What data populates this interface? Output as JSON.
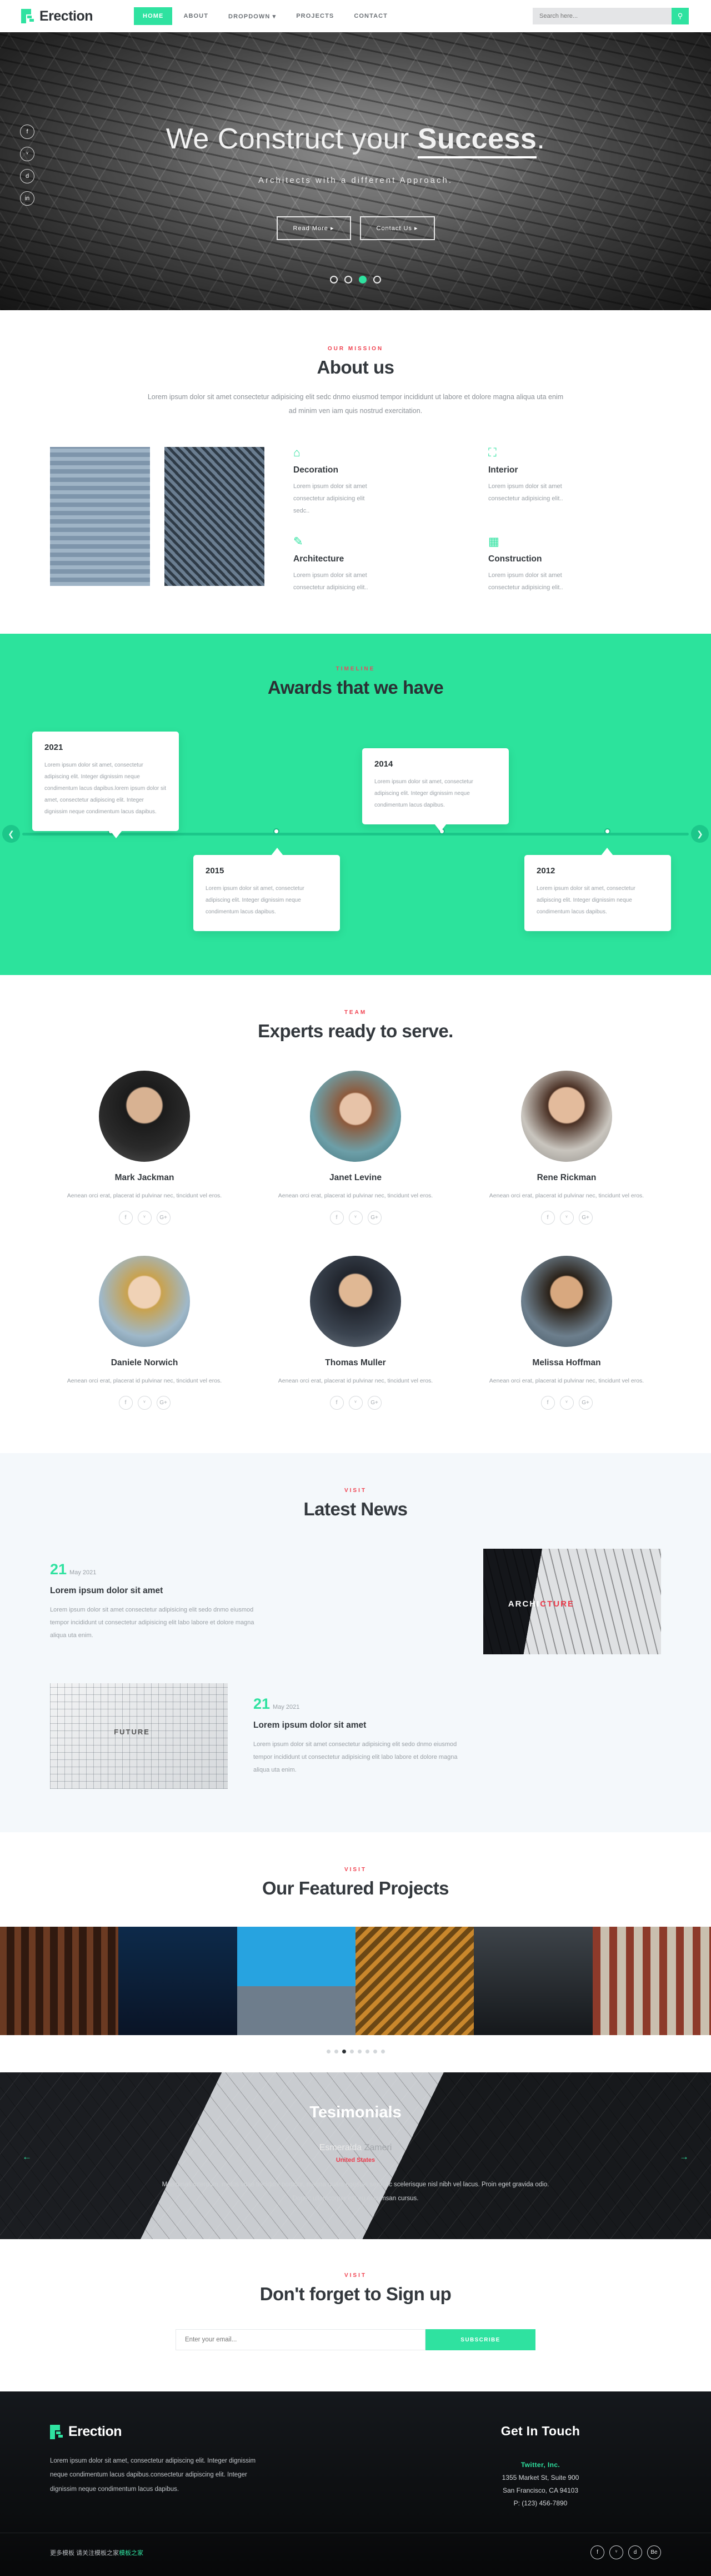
{
  "brand": {
    "name": "Erection"
  },
  "nav": {
    "items": [
      {
        "label": "HOME",
        "active": true
      },
      {
        "label": "ABOUT",
        "active": false
      },
      {
        "label": "DROPDOWN ▾",
        "active": false
      },
      {
        "label": "PROJECTS",
        "active": false
      },
      {
        "label": "CONTACT",
        "active": false
      }
    ],
    "search_placeholder": "Search here...",
    "search_icon": "search-icon"
  },
  "hero": {
    "title_light": "We Construct your ",
    "title_bold": "Success",
    "title_end": ".",
    "subtitle": "Architects with a different Approach.",
    "btn_primary": "Read More ▸",
    "btn_secondary": "Contact Us ▸",
    "social": [
      "f",
      "ᵛ",
      "d",
      "in"
    ],
    "active_dot": 3
  },
  "about": {
    "eyebrow": "OUR MISSION",
    "title": "About us",
    "lead": "Lorem ipsum dolor sit amet consectetur adipisicing elit sedc dnmo eiusmod tempor incididunt ut labore et dolore magna aliqua uta enim ad minim ven iam quis nostrud exercitation.",
    "services": [
      {
        "icon": "home-icon",
        "glyph": "⌂",
        "title": "Decoration",
        "text": "Lorem ipsum dolor sit amet consectetur adipisicing elit sedc.."
      },
      {
        "icon": "expand-icon",
        "glyph": "⛶",
        "title": "Interior",
        "text": "Lorem ipsum dolor sit amet consectetur adipisicing elit.."
      },
      {
        "icon": "pencil-icon",
        "glyph": "✎",
        "title": "Architecture",
        "text": "Lorem ipsum dolor sit amet consectetur adipisicing elit.."
      },
      {
        "icon": "building-icon",
        "glyph": "Ἶ2",
        "title": "Construction",
        "text": "Lorem ipsum dolor sit amet consectetur adipisicing elit.."
      }
    ]
  },
  "timeline": {
    "eyebrow": "TIMELINE",
    "title": "Awards that we have",
    "prev_icon": "chevron-left-icon",
    "next_icon": "chevron-right-icon",
    "cards": [
      {
        "year": "2021",
        "text": "Lorem ipsum dolor sit amet, consectetur adipiscing elit. Integer dignissim neque condimentum lacus dapibus.lorem ipsum dolor sit amet, consectetur adipiscing elit. Integer dignissim neque condimentum lacus dapibus."
      },
      {
        "year": "2015",
        "text": "Lorem ipsum dolor sit amet, consectetur adipiscing elit. Integer dignissim neque condimentum lacus dapibus."
      },
      {
        "year": "2014",
        "text": "Lorem ipsum dolor sit amet, consectetur adipiscing elit. Integer dignissim neque condimentum lacus dapibus."
      },
      {
        "year": "2012",
        "text": "Lorem ipsum dolor sit amet, consectetur adipiscing elit. Integer dignissim neque condimentum lacus dapibus."
      }
    ]
  },
  "team": {
    "eyebrow": "TEAM",
    "title": "Experts ready to serve.",
    "members": [
      {
        "name": "Mark Jackman",
        "bio": "Aenean orci erat, placerat id pulvinar nec, tincidunt vel eros."
      },
      {
        "name": "Janet Levine",
        "bio": "Aenean orci erat, placerat id pulvinar nec, tincidunt vel eros."
      },
      {
        "name": "Rene Rickman",
        "bio": "Aenean orci erat, placerat id pulvinar nec, tincidunt vel eros."
      },
      {
        "name": "Daniele Norwich",
        "bio": "Aenean orci erat, placerat id pulvinar nec, tincidunt vel eros."
      },
      {
        "name": "Thomas Muller",
        "bio": "Aenean orci erat, placerat id pulvinar nec, tincidunt vel eros."
      },
      {
        "name": "Melissa Hoffman",
        "bio": "Aenean orci erat, placerat id pulvinar nec, tincidunt vel eros."
      }
    ],
    "social": [
      "f",
      "ᵛ",
      "G+"
    ]
  },
  "news": {
    "eyebrow": "VISIT",
    "title": "Latest News",
    "posts": [
      {
        "day": "21",
        "date": "May 2021",
        "title": "Lorem ipsum dolor sit amet",
        "text": "Lorem ipsum dolor sit amet consectetur adipisicing elit sedo dnmo eiusmod tempor incididunt ut consectetur adipisicing elit labo labore et dolore magna aliqua uta enim.",
        "image_caption_a": "ARCHI",
        "image_caption_b": "CTURE"
      },
      {
        "day": "21",
        "date": "May 2021",
        "title": "Lorem ipsum dolor sit amet",
        "text": "Lorem ipsum dolor sit amet consectetur adipisicing elit sedo dnmo eiusmod tempor incididunt ut consectetur adipisicing elit labo labore et dolore magna aliqua uta enim.",
        "image_caption_a": "FUTURE",
        "image_caption_b": ""
      }
    ]
  },
  "projects": {
    "eyebrow": "VISIT",
    "title": "Our Featured Projects",
    "dots": 8,
    "active_dot": 2
  },
  "testimonials": {
    "title": "Tesimonials",
    "author_first": "Esmeralda",
    "author_last": " Zameri",
    "country": "United States",
    "quote": "Maecenas interdum, metus vitae tincidunt porttitor, magna quam egestas sem, ac scelerisque nisl nibh vel lacus. Proin eget gravida odio. Donec ullamcorper est eu accumsan cursus.",
    "prev_icon": "arrow-left-icon",
    "next_icon": "arrow-right-icon"
  },
  "signup": {
    "eyebrow": "VISIT",
    "title": "Don't forget to Sign up",
    "placeholder": "Enter your email...",
    "button": "SUBSCRIBE"
  },
  "footer": {
    "brand": "Erection",
    "about": "Lorem ipsum dolor sit amet, consectetur adipiscing elit. Integer dignissim neque condimentum lacus dapibus.consectetur adipiscing elit. Integer dignissim neque condimentum lacus dapibus.",
    "contact_title": "Get In Touch",
    "company": "Twitter, Inc.",
    "address1": "1355 Market St, Suite 900",
    "address2": "San Francisco, CA 94103",
    "phone": "P: (123) 456-7890",
    "bottom_text_a": "更多模板 请关注模板之家",
    "bottom_text_b": "模板之家",
    "social": [
      "f",
      "ᵛ",
      "d",
      "Be"
    ]
  },
  "colors": {
    "accent": "#2fe2a0",
    "red": "#f0414f",
    "dark": "#33383d"
  }
}
